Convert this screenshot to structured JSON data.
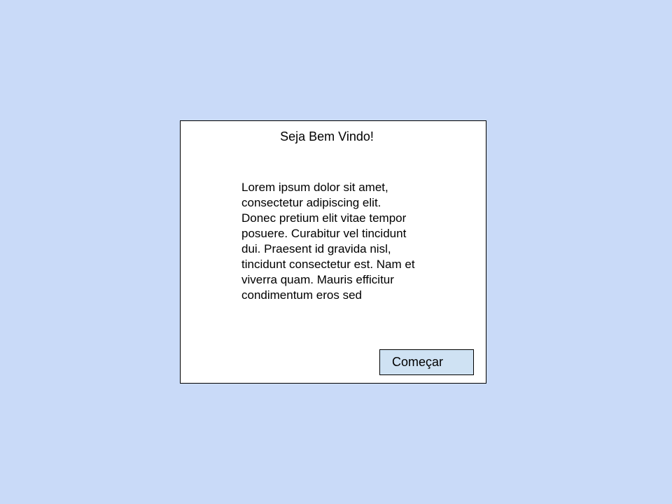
{
  "dialog": {
    "title": "Seja Bem Vindo!",
    "body": "Lorem ipsum dolor sit amet, consectetur adipiscing elit. Donec pretium elit vitae tempor posuere. Curabitur vel tincidunt dui. Praesent id gravida nisl, tincidunt consectetur est. Nam et viverra quam. Mauris efficitur condimentum eros sed",
    "start_button_label": "Começar"
  },
  "colors": {
    "page_background": "#c9daf8",
    "dialog_background": "#ffffff",
    "button_background": "#cfe2f3",
    "border": "#000000"
  }
}
